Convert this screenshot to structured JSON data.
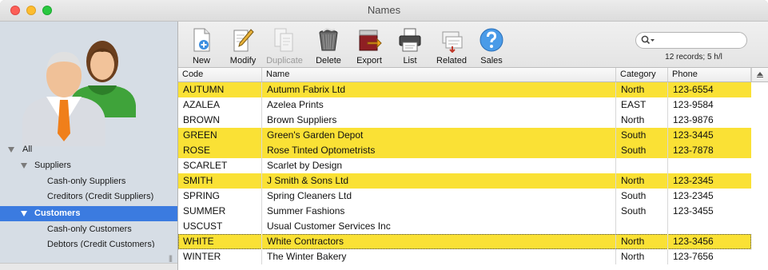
{
  "window": {
    "title": "Names"
  },
  "sidebar": {
    "items": [
      {
        "label": "All",
        "expanded": true
      },
      {
        "label": "Suppliers",
        "expanded": true
      },
      {
        "label": "Cash-only Suppliers"
      },
      {
        "label": "Creditors (Credit Suppliers)"
      },
      {
        "label": "Customers",
        "expanded": true,
        "selected": true
      },
      {
        "label": "Cash-only Customers"
      },
      {
        "label": "Debtors (Credit Customers)"
      }
    ]
  },
  "toolbar": {
    "buttons": [
      {
        "label": "New",
        "icon": "new-document-icon"
      },
      {
        "label": "Modify",
        "icon": "modify-pencil-icon"
      },
      {
        "label": "Duplicate",
        "icon": "duplicate-icon",
        "disabled": true
      },
      {
        "label": "Delete",
        "icon": "trash-icon"
      },
      {
        "label": "Export",
        "icon": "export-icon"
      },
      {
        "label": "List",
        "icon": "printer-icon"
      },
      {
        "label": "Related",
        "icon": "related-icon"
      },
      {
        "label": "Sales",
        "icon": "help-question-icon"
      }
    ],
    "search_placeholder": "",
    "records_text": "12 records; 5 h/l"
  },
  "table": {
    "headers": [
      "Code",
      "Name",
      "Category",
      "Phone"
    ],
    "rows": [
      {
        "code": "AUTUMN",
        "name": "Autumn Fabrix Ltd",
        "category": "North",
        "phone": "123-6554",
        "highlighted": true
      },
      {
        "code": "AZALEA",
        "name": "Azelea Prints",
        "category": "EAST",
        "phone": "123-9584",
        "highlighted": false
      },
      {
        "code": "BROWN",
        "name": "Brown Suppliers",
        "category": "North",
        "phone": "123-9876",
        "highlighted": false
      },
      {
        "code": "GREEN",
        "name": "Green's Garden Depot",
        "category": "South",
        "phone": "123-3445",
        "highlighted": true
      },
      {
        "code": "ROSE",
        "name": "Rose Tinted Optometrists",
        "category": "South",
        "phone": "123-7878",
        "highlighted": true
      },
      {
        "code": "SCARLET",
        "name": "Scarlet by Design",
        "category": "",
        "phone": "",
        "highlighted": false
      },
      {
        "code": "SMITH",
        "name": "J Smith & Sons Ltd",
        "category": "North",
        "phone": "123-2345",
        "highlighted": true
      },
      {
        "code": "SPRING",
        "name": "Spring Cleaners Ltd",
        "category": "South",
        "phone": "123-2345",
        "highlighted": false
      },
      {
        "code": "SUMMER",
        "name": "Summer Fashions",
        "category": "South",
        "phone": "123-3455",
        "highlighted": false
      },
      {
        "code": "USCUST",
        "name": "Usual Customer Services Inc",
        "category": "",
        "phone": "",
        "highlighted": false
      },
      {
        "code": "WHITE",
        "name": "White Contractors",
        "category": "North",
        "phone": "123-3456",
        "highlighted": true,
        "focused": true
      },
      {
        "code": "WINTER",
        "name": "The Winter Bakery",
        "category": "North",
        "phone": "123-7656",
        "highlighted": false
      }
    ]
  },
  "colors": {
    "highlight": "#fae135",
    "selection": "#3b7be0",
    "sidebar": "#d6dde5"
  }
}
